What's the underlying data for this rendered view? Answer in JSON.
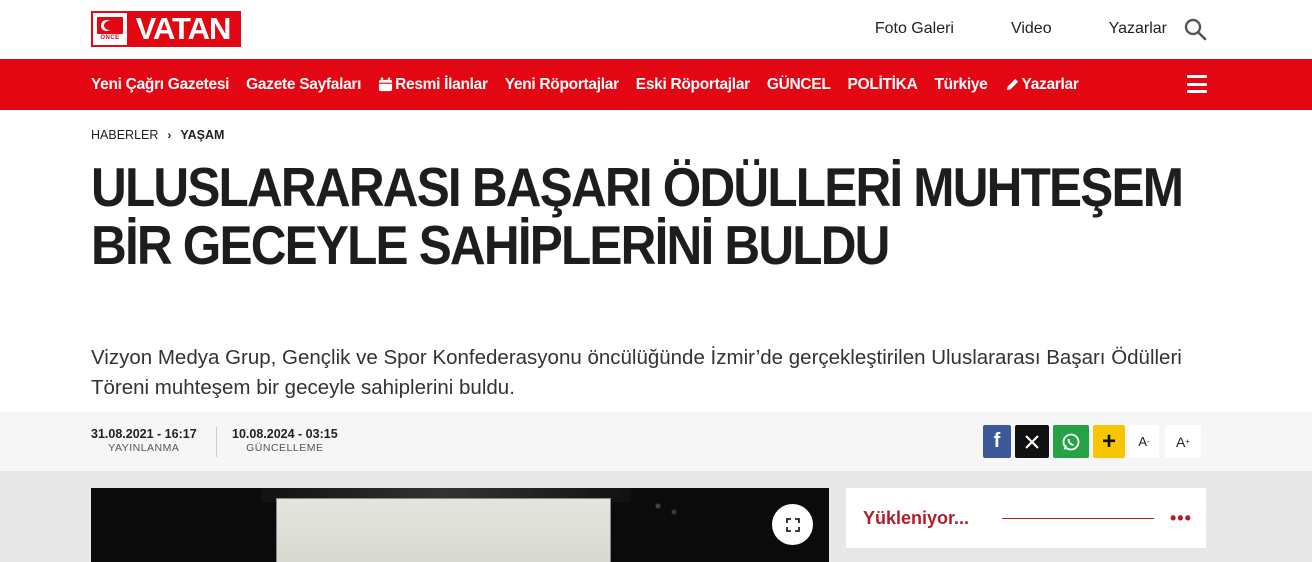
{
  "brand": {
    "logo_text": "VATAN",
    "logo_sub": "ÖNCE",
    "accent": "#e30613"
  },
  "top_links": [
    "Foto Galeri",
    "Video",
    "Yazarlar"
  ],
  "nav": {
    "items": [
      {
        "label": "Yeni Çağrı Gazetesi",
        "icon": ""
      },
      {
        "label": "Gazete Sayfaları",
        "icon": ""
      },
      {
        "label": "Resmi İlanlar",
        "icon": "calendar-icon"
      },
      {
        "label": "Yeni Röportajlar",
        "icon": ""
      },
      {
        "label": "Eski Röportajlar",
        "icon": ""
      },
      {
        "label": "GÜNCEL",
        "icon": ""
      },
      {
        "label": "POLİTİKA",
        "icon": ""
      },
      {
        "label": "Türkiye",
        "icon": ""
      },
      {
        "label": "Yazarlar",
        "icon": "pen-icon"
      }
    ]
  },
  "breadcrumb": {
    "home": "HABERLER",
    "current": "YAŞAM"
  },
  "article": {
    "title": "ULUSLARARASI BAŞARI ÖDÜLLERİ MUHTEŞEM BİR GECEYLE SAHİPLERİNİ BULDU",
    "spot": "Vizyon Medya Grup, Gençlik ve Spor Konfederasyonu öncülüğünde İzmir’de gerçekleştirilen Uluslararası Başarı Ödülleri Töreni muhteşem bir geceyle sahiplerini buldu.",
    "published_date": "31.08.2021 - 16:17",
    "published_label": "YAYINLANMA",
    "updated_date": "10.08.2024 - 03:15",
    "updated_label": "GÜNCELLEME"
  },
  "share": {
    "facebook": "f",
    "plus": "+",
    "font_small": "A",
    "font_small_sup": "-",
    "font_large": "A",
    "font_large_sup": "+"
  },
  "sidebar": {
    "title": "Yükleniyor...",
    "more": "•••"
  }
}
